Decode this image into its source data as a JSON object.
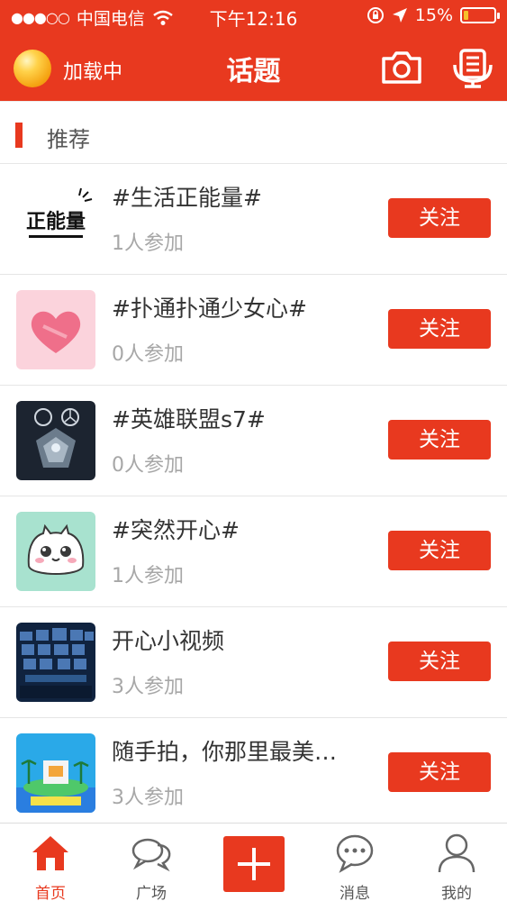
{
  "status_bar": {
    "signal_dots": "●●●○○",
    "carrier": "中国电信",
    "time": "下午12:16",
    "battery_text": "15%",
    "battery_level": 0.15,
    "battery_color": "#f6c12b"
  },
  "header": {
    "loading_label": "加载中",
    "title": "话题",
    "left_icon": "loading-ball-icon",
    "right_icons": [
      "camera-icon",
      "live-broadcast-icon"
    ]
  },
  "section": {
    "title": "推荐"
  },
  "topics": [
    {
      "title": "#生活正能量#",
      "participants": "1人参加",
      "follow_label": "关注",
      "thumb_text": "正能量"
    },
    {
      "title": "#扑通扑通少女心#",
      "participants": "0人参加",
      "follow_label": "关注",
      "thumb_text": ""
    },
    {
      "title": "#英雄联盟s7#",
      "participants": "0人参加",
      "follow_label": "关注",
      "thumb_text": ""
    },
    {
      "title": "#突然开心#",
      "participants": "1人参加",
      "follow_label": "关注",
      "thumb_text": ""
    },
    {
      "title": "开心小视频",
      "participants": "3人参加",
      "follow_label": "关注",
      "thumb_text": ""
    },
    {
      "title": "随手拍，你那里最美…",
      "participants": "3人参加",
      "follow_label": "关注",
      "thumb_text": ""
    }
  ],
  "tabbar": {
    "tabs": [
      {
        "label": "首页",
        "icon": "home-icon",
        "active": true
      },
      {
        "label": "广场",
        "icon": "chat-bubbles-icon",
        "active": false
      },
      {
        "label": "",
        "icon": "plus-icon",
        "active": false
      },
      {
        "label": "消息",
        "icon": "message-icon",
        "active": false
      },
      {
        "label": "我的",
        "icon": "user-icon",
        "active": false
      }
    ]
  },
  "colors": {
    "accent": "#e8391f",
    "muted_text": "#a7a7a7"
  }
}
